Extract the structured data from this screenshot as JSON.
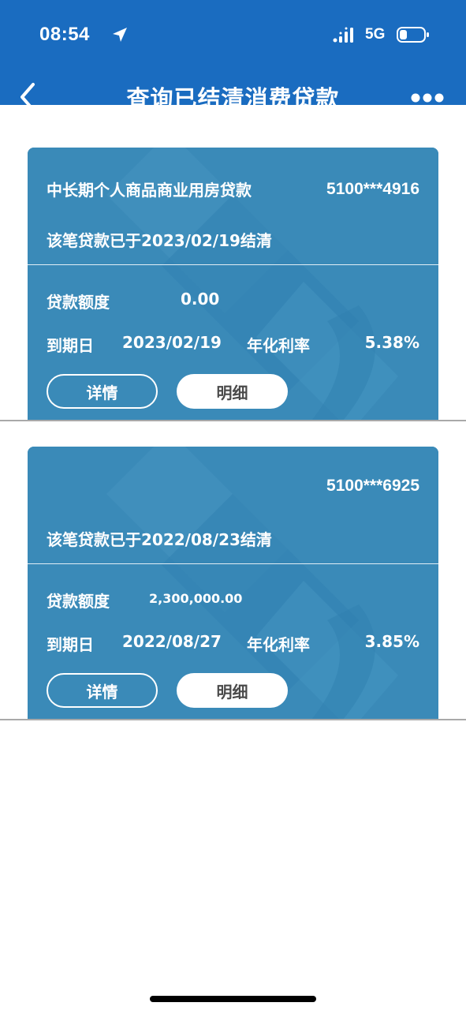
{
  "status_bar": {
    "time": "08:54",
    "network": "5G",
    "icons": [
      "location-arrow-icon",
      "signal-icon",
      "battery-icon"
    ]
  },
  "nav": {
    "title": "查询已结清消费贷款",
    "back_icon": "chevron-left-icon",
    "more_icon": "more-icon"
  },
  "colors": {
    "header_bg": "#1a6cc0",
    "card_bg": "#3a8ab8",
    "button_text": "#4a4a4a"
  },
  "loans": [
    {
      "product_name": "中长期个人商品商业用房贷款",
      "account": "5100***4916",
      "settled_text": "该笔贷款已于2023/02/19结清",
      "amount_label": "贷款额度",
      "amount_value": "0.00",
      "due_label": "到期日",
      "due_value": "2023/02/19",
      "rate_label": "年化利率",
      "rate_value": "5.38%",
      "detail_button": "详情",
      "statement_button": "明细"
    },
    {
      "product_name": "",
      "account": "5100***6925",
      "settled_text": "该笔贷款已于2022/08/23结清",
      "amount_label": "贷款额度",
      "amount_value": "2,300,000.00",
      "due_label": "到期日",
      "due_value": "2022/08/27",
      "rate_label": "年化利率",
      "rate_value": "3.85%",
      "detail_button": "详情",
      "statement_button": "明细"
    }
  ]
}
